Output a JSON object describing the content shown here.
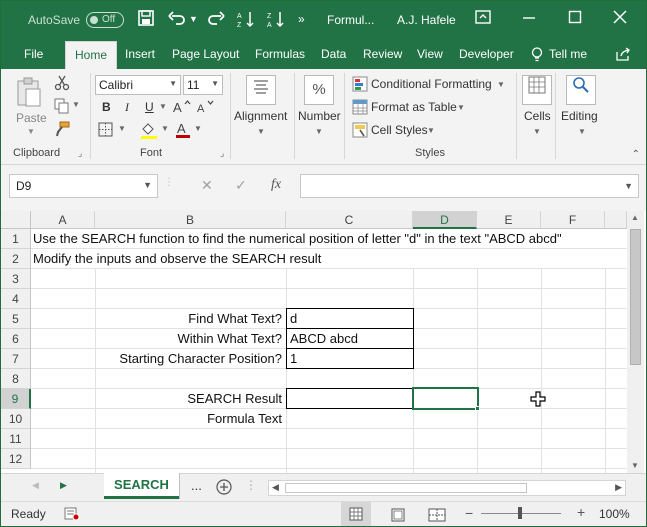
{
  "titlebar": {
    "autosave_label": "AutoSave",
    "autosave_state": "Off",
    "filename": "Formul...",
    "user": "A.J. Hafele"
  },
  "ribbon_tabs": [
    "File",
    "Home",
    "Insert",
    "Page Layout",
    "Formulas",
    "Data",
    "Review",
    "View",
    "Developer",
    "Tell me"
  ],
  "ribbon": {
    "clipboard": {
      "paste": "Paste",
      "label": "Clipboard"
    },
    "font": {
      "family": "Calibri",
      "size": "11",
      "label": "Font",
      "bold": "B",
      "italic": "I",
      "underline": "U"
    },
    "alignment": {
      "label": "Alignment"
    },
    "number": {
      "label": "Number",
      "symbol": "%"
    },
    "styles": {
      "conditional": "Conditional Formatting",
      "table": "Format as Table",
      "cell_styles": "Cell Styles",
      "label": "Styles"
    },
    "cells": {
      "label": "Cells"
    },
    "editing": {
      "label": "Editing"
    }
  },
  "formula_bar": {
    "name_box": "D9",
    "cancel": "✕",
    "enter": "✓",
    "fx": "fx",
    "content": ""
  },
  "columns": [
    "A",
    "B",
    "C",
    "D",
    "E",
    "F"
  ],
  "rows": [
    "1",
    "2",
    "3",
    "4",
    "5",
    "6",
    "7",
    "8",
    "9",
    "10",
    "11",
    "12"
  ],
  "cells": {
    "A1": "Use the SEARCH function to find the numerical position of letter \"d\" in the text \"ABCD abcd\"",
    "A2": "Modify the inputs and observe the SEARCH result",
    "B5": "Find What Text?",
    "C5": "d",
    "B6": "Within What Text?",
    "C6": "ABCD abcd",
    "B7": "Starting Character Position?",
    "C7": "1",
    "B9": "SEARCH Result",
    "C9": "",
    "B10": "Formula Text"
  },
  "sheet_tabs": {
    "active": "SEARCH",
    "more": "..."
  },
  "statusbar": {
    "status": "Ready",
    "zoom": "100%"
  },
  "colors": {
    "brand": "#217346"
  }
}
